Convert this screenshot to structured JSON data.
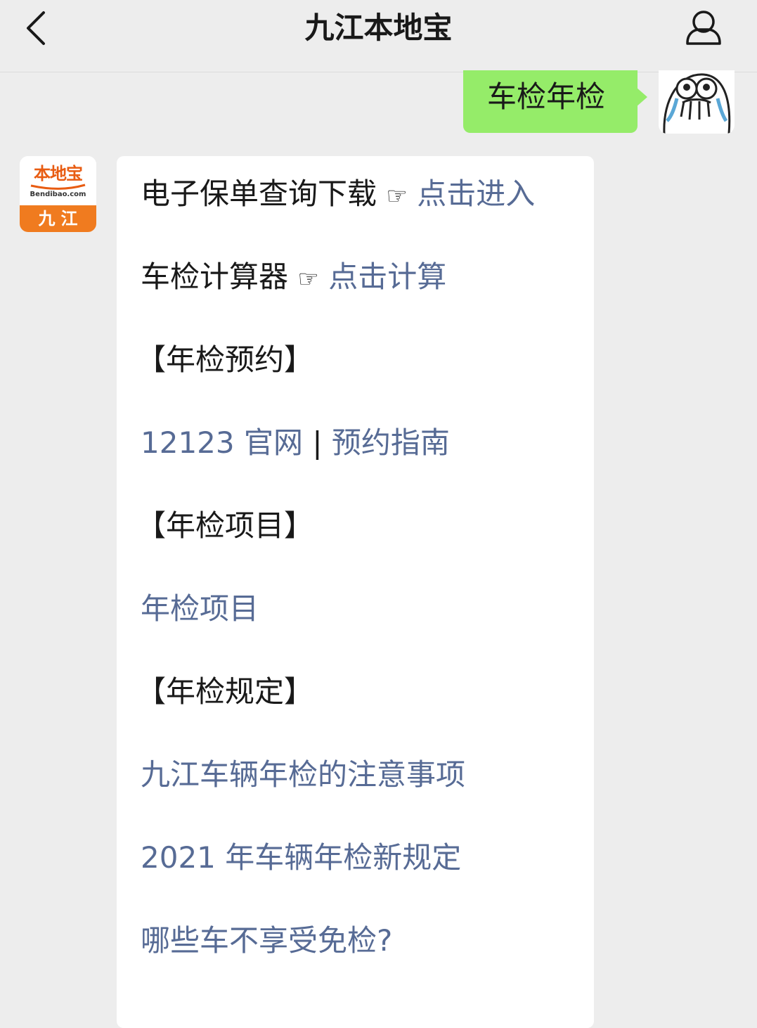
{
  "nav": {
    "title": "九江本地宝",
    "back_icon": "chevron-left-icon",
    "profile_icon": "person-icon"
  },
  "user_message": {
    "text": "车检年检",
    "avatar": "crying-meme-avatar",
    "bubble_color": "#95ec69"
  },
  "account": {
    "avatar_brand": "本地宝",
    "avatar_domain": "Bendibao.com",
    "avatar_city": "九江",
    "brand_color": "#e85c12",
    "banner_color": "#f07b1f"
  },
  "reply": {
    "link_color": "#576b95",
    "lines": [
      {
        "label": "电子保单查询下载",
        "pointer": "☞",
        "link": "点击进入"
      },
      {
        "label": "车检计算器",
        "pointer": "☞",
        "link": "点击计算"
      },
      {
        "heading": "【年检预约】"
      },
      {
        "link_a": "12123 官网",
        "separator": "|",
        "link_b": "预约指南"
      },
      {
        "heading": "【年检项目】"
      },
      {
        "link": "年检项目"
      },
      {
        "heading": "【年检规定】"
      },
      {
        "link": "九江车辆年检的注意事项"
      },
      {
        "link": "2021 年车辆年检新规定"
      },
      {
        "link": "哪些车不享受免检?"
      }
    ]
  }
}
